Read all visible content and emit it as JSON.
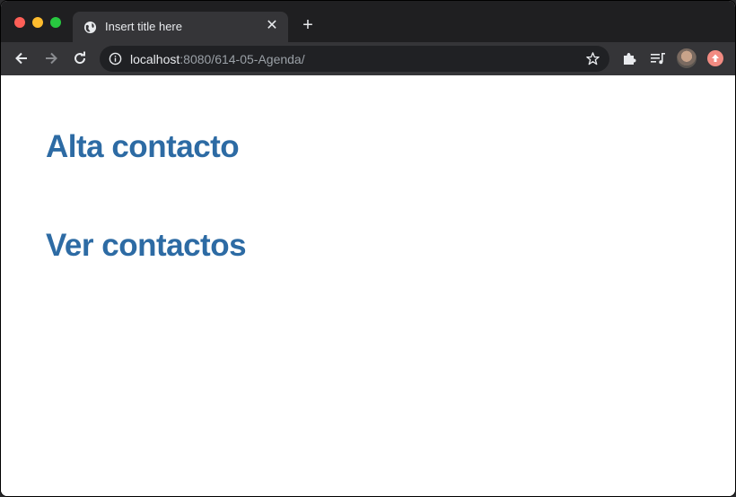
{
  "browser": {
    "tab": {
      "title": "Insert title here"
    },
    "address": {
      "host": "localhost",
      "rest": ":8080/614-05-Agenda/"
    },
    "colors": {
      "frame": "#1f1f21",
      "toolbar": "#353538",
      "omnibox": "#202124"
    }
  },
  "page": {
    "links": [
      {
        "label": "Alta contacto"
      },
      {
        "label": "Ver contactos"
      }
    ],
    "link_color": "#2d6ba4"
  }
}
